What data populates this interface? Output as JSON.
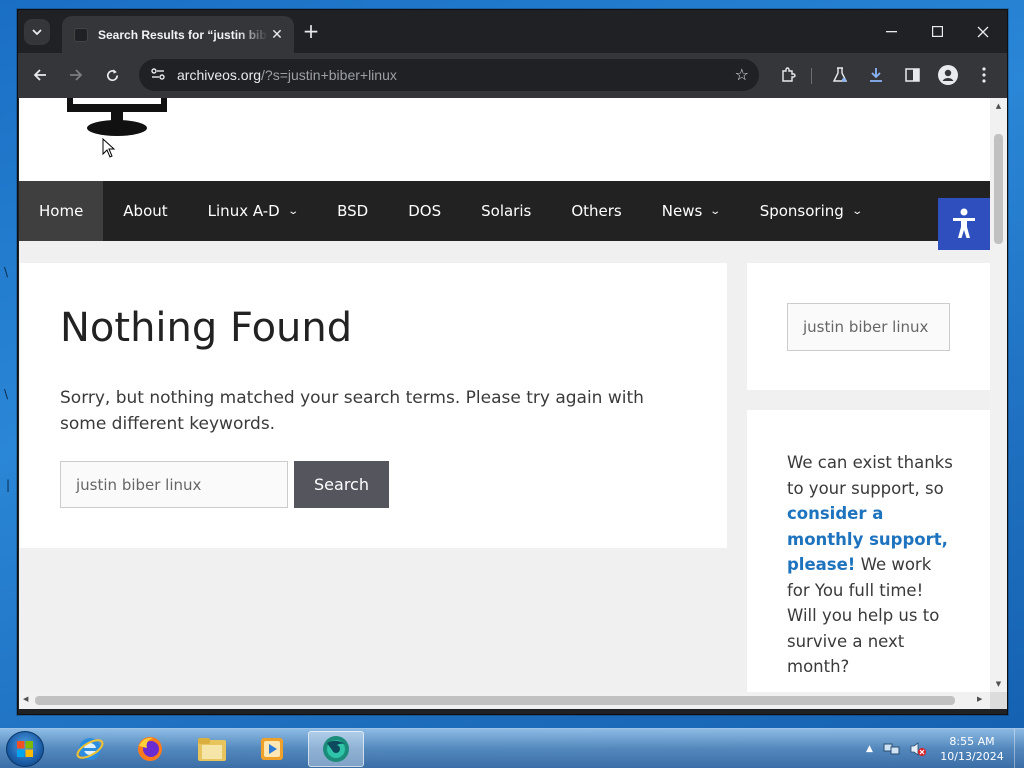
{
  "browser": {
    "tab_title": "Search Results for “justin biber linux” – ArchiveOS",
    "url_host": "archiveos.org",
    "url_path": "/?s=justin+biber+linux"
  },
  "nav": {
    "items": [
      {
        "label": "Home",
        "active": true,
        "dropdown": false
      },
      {
        "label": "About",
        "active": false,
        "dropdown": false
      },
      {
        "label": "Linux A-D",
        "active": false,
        "dropdown": true
      },
      {
        "label": "BSD",
        "active": false,
        "dropdown": false
      },
      {
        "label": "DOS",
        "active": false,
        "dropdown": false
      },
      {
        "label": "Solaris",
        "active": false,
        "dropdown": false
      },
      {
        "label": "Others",
        "active": false,
        "dropdown": false
      },
      {
        "label": "News",
        "active": false,
        "dropdown": true
      },
      {
        "label": "Sponsoring",
        "active": false,
        "dropdown": true
      }
    ]
  },
  "main": {
    "title": "Nothing Found",
    "message": "Sorry, but nothing matched your search terms. Please try again with some different keywords.",
    "search_value": "justin biber linux",
    "search_button": "Search"
  },
  "sidebar": {
    "search_value": "justin biber linux",
    "support_text_1": "We can exist thanks to your support, so",
    "support_link": "consider a monthly support, please!",
    "support_text_2": "We work for You full time! Will you help us to survive a next month?"
  },
  "taskbar": {
    "time": "8:55 AM",
    "date": "10/13/2024"
  },
  "colors": {
    "nav_bg": "#222222",
    "nav_active": "#3f3f3f",
    "link": "#1e73be",
    "accessibility": "#2f4fbf"
  }
}
